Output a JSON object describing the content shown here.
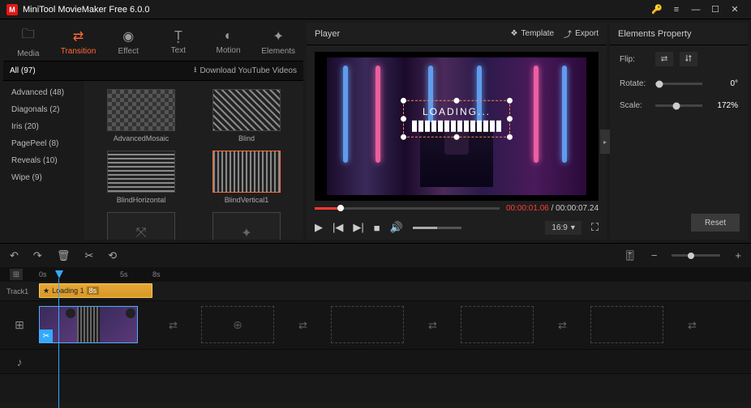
{
  "app": {
    "title": "MiniTool MovieMaker Free 6.0.0"
  },
  "toolbar": {
    "media": "Media",
    "transition": "Transition",
    "effect": "Effect",
    "text": "Text",
    "motion": "Motion",
    "elements": "Elements"
  },
  "catbar": {
    "all": "All (97)",
    "download": "Download YouTube Videos"
  },
  "sidebar": {
    "items": [
      {
        "label": "Advanced (48)"
      },
      {
        "label": "Diagonals (2)"
      },
      {
        "label": "Iris (20)"
      },
      {
        "label": "PagePeel (8)"
      },
      {
        "label": "Reveals (10)"
      },
      {
        "label": "Wipe (9)"
      }
    ]
  },
  "thumbs": [
    {
      "label": "AdvancedMosaic"
    },
    {
      "label": "Blind"
    },
    {
      "label": "BlindHorizontal"
    },
    {
      "label": "BlindVertical1"
    }
  ],
  "player": {
    "label": "Player",
    "template": "Template",
    "export": "Export",
    "loading_text": "LOADING...",
    "current_time": "00:00:01.06",
    "total_time": "00:00:07.24",
    "aspect": "16:9"
  },
  "props": {
    "title": "Elements Property",
    "flip": "Flip:",
    "rotate": "Rotate:",
    "scale": "Scale:",
    "rotate_val": "0°",
    "scale_val": "172%",
    "reset": "Reset"
  },
  "timeline": {
    "ticks": [
      "0s",
      "5s",
      "8s"
    ],
    "track1": "Track1",
    "clip": {
      "name": "Loading 1",
      "dur": "8s"
    }
  }
}
